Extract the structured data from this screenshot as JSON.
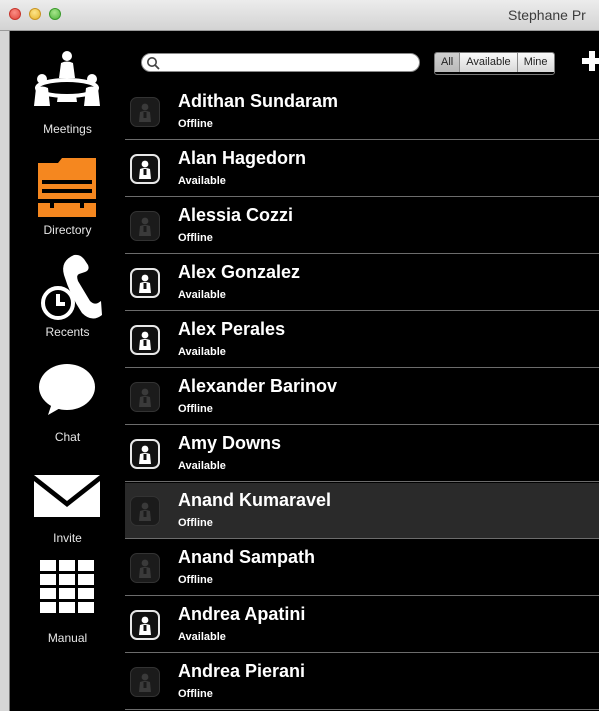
{
  "window": {
    "title": "Stephane Pr"
  },
  "sidebar": {
    "items": [
      {
        "label": "Meetings",
        "icon": "meetings-icon"
      },
      {
        "label": "Directory",
        "icon": "directory-icon",
        "active": true,
        "accent": "#f5871f"
      },
      {
        "label": "Recents",
        "icon": "recents-icon"
      },
      {
        "label": "Chat",
        "icon": "chat-icon"
      },
      {
        "label": "Invite",
        "icon": "invite-icon"
      },
      {
        "label": "Manual",
        "icon": "keypad-icon"
      }
    ]
  },
  "toolbar": {
    "search": {
      "value": "",
      "placeholder": ""
    },
    "filters": [
      {
        "label": "All",
        "selected": true
      },
      {
        "label": "Available",
        "selected": false
      },
      {
        "label": "Mine",
        "selected": false
      }
    ],
    "add_icon": "plus-icon"
  },
  "contacts": [
    {
      "name": "Adithan Sundaram",
      "status": "Offline"
    },
    {
      "name": "Alan Hagedorn",
      "status": "Available"
    },
    {
      "name": "Alessia Cozzi",
      "status": "Offline"
    },
    {
      "name": "Alex Gonzalez",
      "status": "Available"
    },
    {
      "name": "Alex Perales",
      "status": "Available"
    },
    {
      "name": "Alexander Barinov",
      "status": "Offline"
    },
    {
      "name": "Amy Downs",
      "status": "Available"
    },
    {
      "name": "Anand Kumaravel",
      "status": "Offline",
      "selected": true
    },
    {
      "name": "Anand Sampath",
      "status": "Offline"
    },
    {
      "name": "Andrea Apatini",
      "status": "Available"
    },
    {
      "name": "Andrea Pierani",
      "status": "Offline"
    }
  ],
  "colors": {
    "accent": "#f5871f",
    "background": "#000000",
    "text": "#ffffff"
  }
}
